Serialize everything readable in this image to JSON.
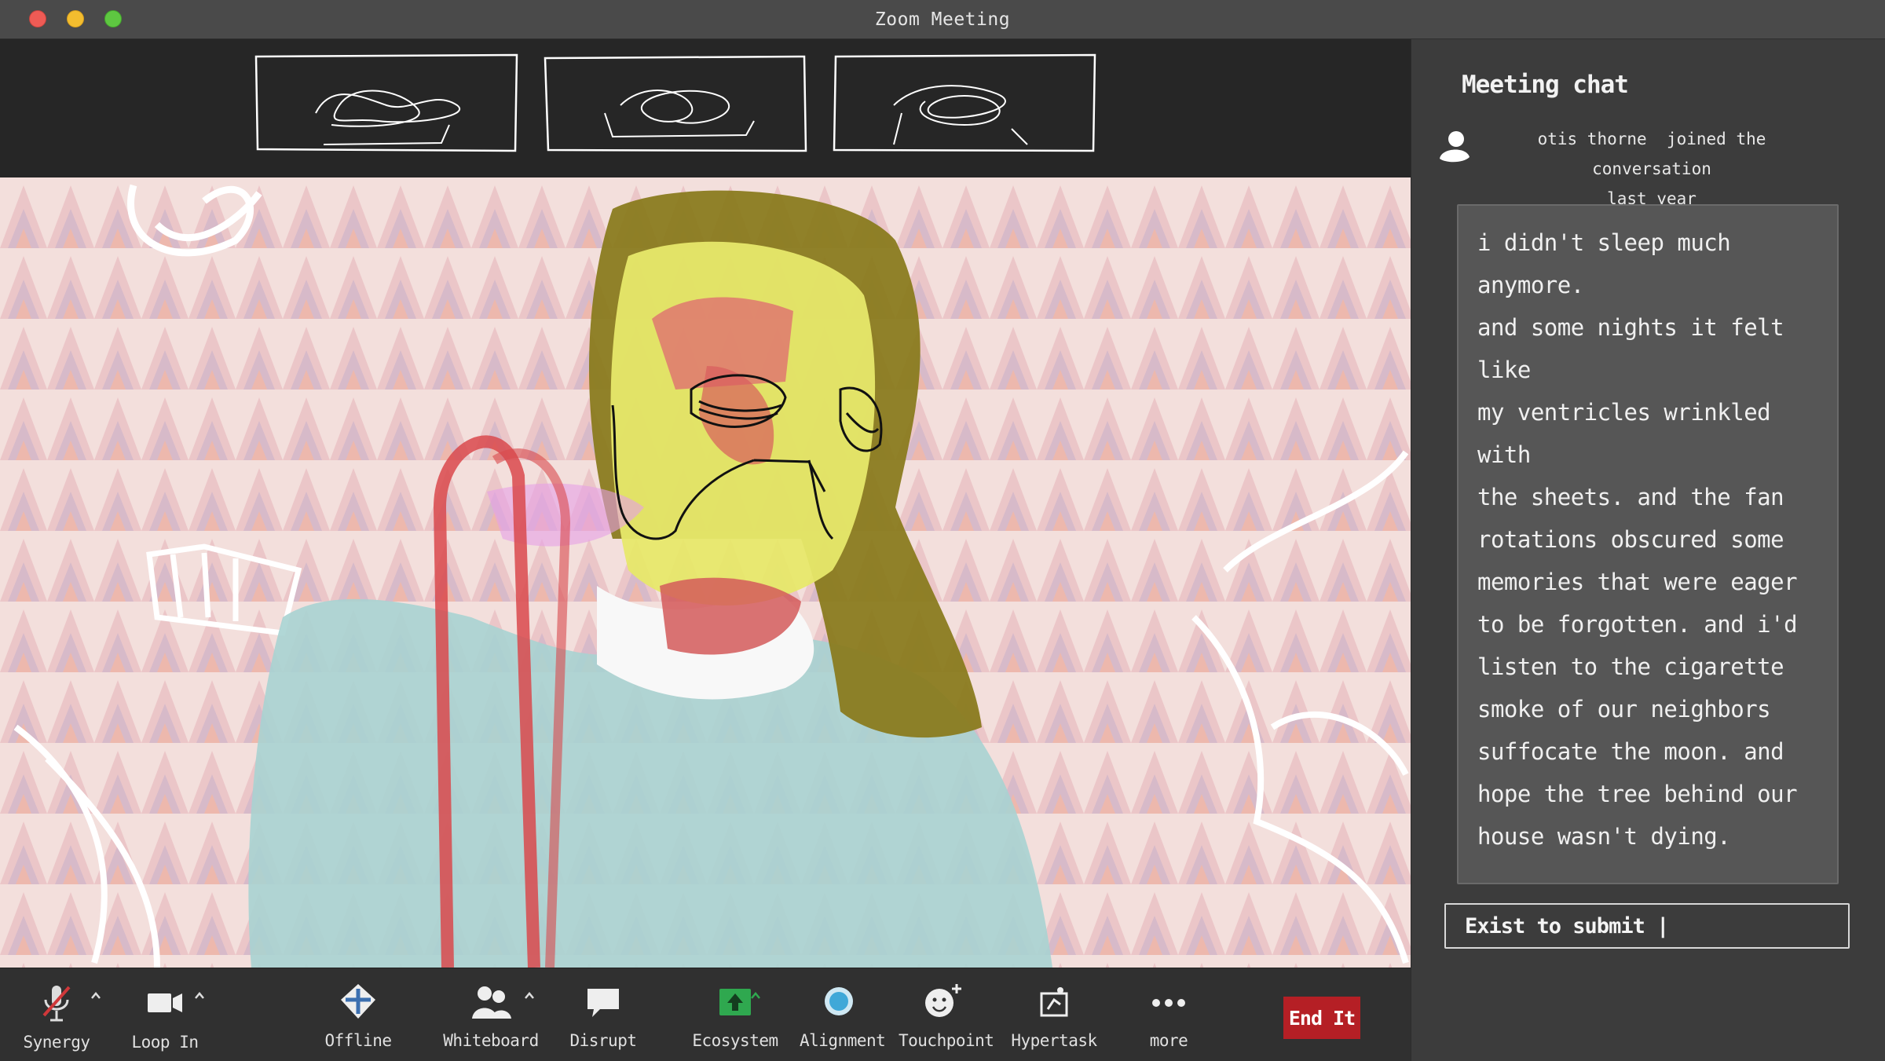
{
  "window": {
    "title": "Zoom Meeting"
  },
  "gallery": {
    "thumbnails": [
      {
        "id": "participant-1"
      },
      {
        "id": "participant-2"
      },
      {
        "id": "participant-3"
      }
    ]
  },
  "chat": {
    "title": "Meeting chat",
    "join_notice": {
      "name": "otis thorne",
      "action": "joined the conversation",
      "time": "last year"
    },
    "message": "i didn't sleep much anymore.\nand some nights it felt like\nmy ventricles wrinkled with\nthe sheets. and the fan\nrotations obscured some\nmemories that were eager\nto be forgotten. and i'd\nlisten to the cigarette\nsmoke of our neighbors\nsuffocate the moon. and\nhope the tree behind our\nhouse wasn't dying.",
    "input_value": "Exist to submit |"
  },
  "toolbar": {
    "items": [
      {
        "label": "Synergy",
        "icon": "microphone-muted-icon"
      },
      {
        "label": "Loop In",
        "icon": "video-camera-icon"
      },
      {
        "label": "Offline",
        "icon": "security-shield-icon"
      },
      {
        "label": "Whiteboard",
        "icon": "participants-icon"
      },
      {
        "label": "Disrupt",
        "icon": "chat-bubble-icon"
      },
      {
        "label": "Ecosystem",
        "icon": "share-screen-icon"
      },
      {
        "label": "Alignment",
        "icon": "record-icon"
      },
      {
        "label": "Touchpoint",
        "icon": "reactions-icon"
      },
      {
        "label": "Hypertask",
        "icon": "apps-icon"
      },
      {
        "label": "more",
        "icon": "more-dots-icon"
      }
    ],
    "end_label": "End It"
  },
  "colors": {
    "end_button": "#b51f25",
    "share_green": "#2fa84f",
    "mic_slash": "#d0383a",
    "titlebar": "#4a4a4a",
    "panel": "#3c3c3c"
  }
}
